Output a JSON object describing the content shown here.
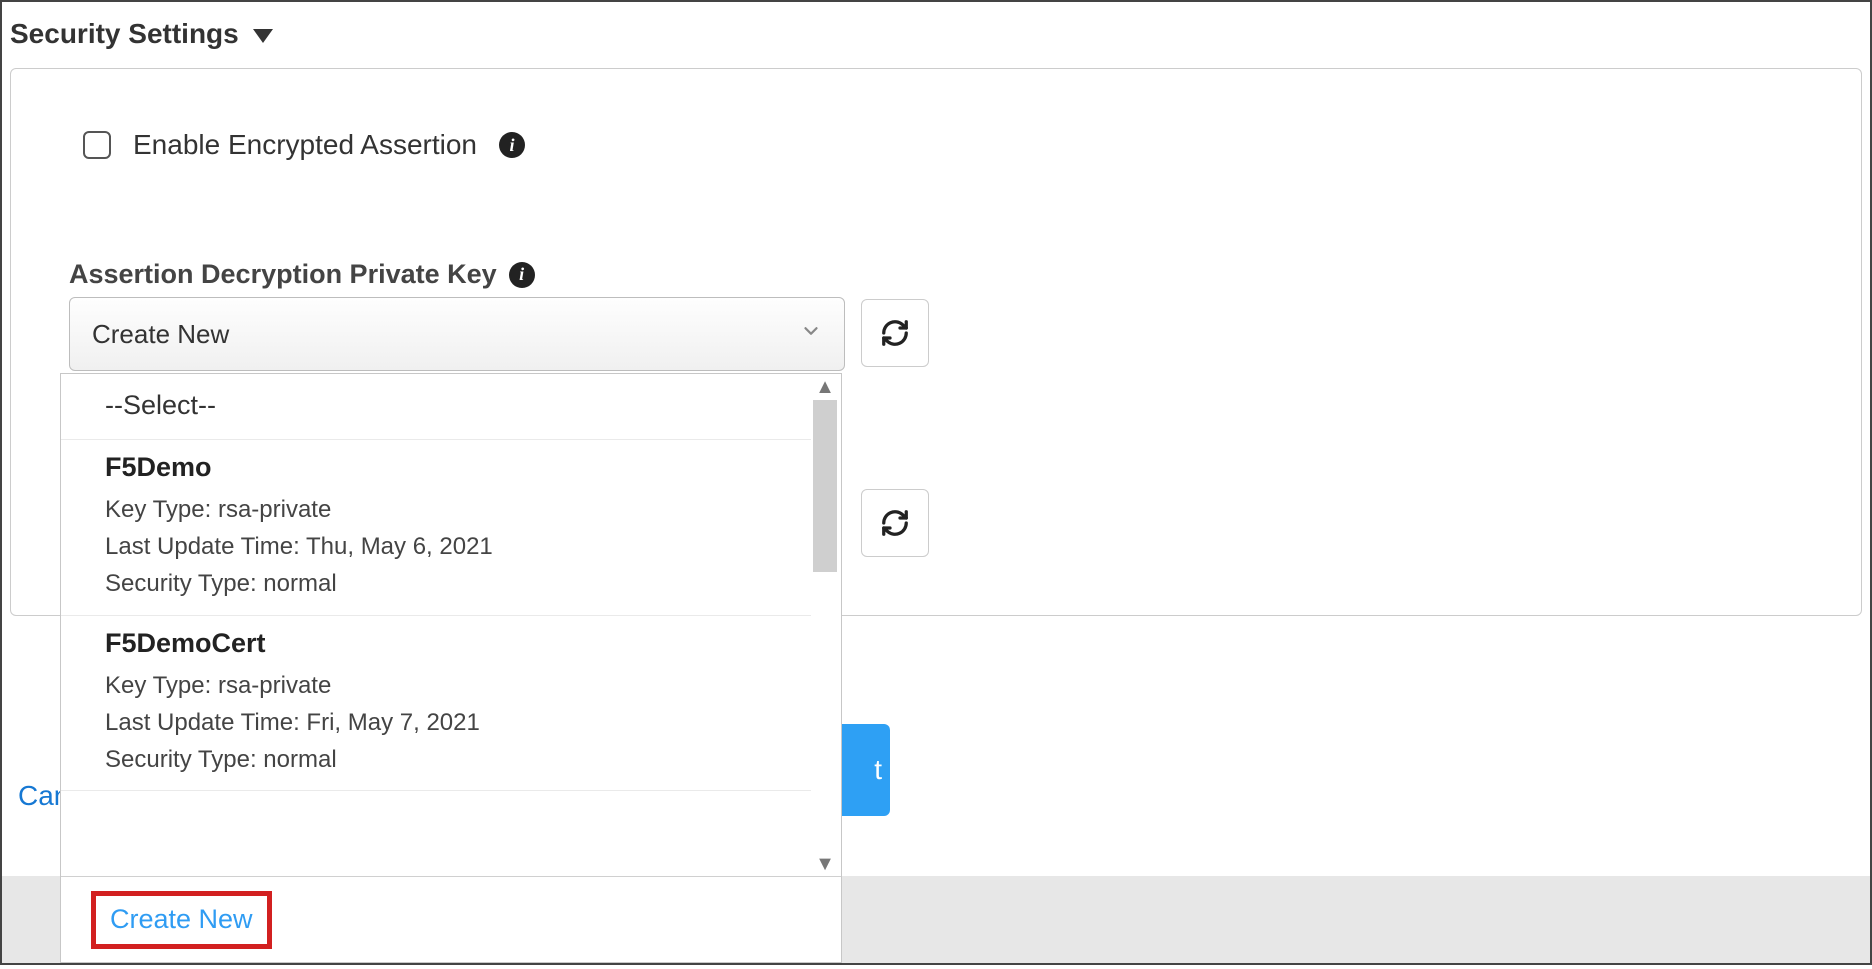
{
  "section": {
    "title": "Security Settings"
  },
  "checkbox": {
    "label": "Enable Encrypted Assertion"
  },
  "field": {
    "label": "Assertion Decryption Private Key"
  },
  "select": {
    "value": "Create New"
  },
  "dropdown": {
    "placeholder": "--Select--",
    "items": [
      {
        "title": "F5Demo",
        "key_type": "Key Type: rsa-private",
        "last_update": "Last Update Time: Thu, May 6, 2021",
        "security_type": "Security Type: normal"
      },
      {
        "title": "F5DemoCert",
        "key_type": "Key Type: rsa-private",
        "last_update": "Last Update Time: Fri, May 7, 2021",
        "security_type": "Security Type: normal"
      }
    ],
    "create_new": "Create New"
  },
  "footer": {
    "cancel": "Can",
    "next": "t"
  }
}
